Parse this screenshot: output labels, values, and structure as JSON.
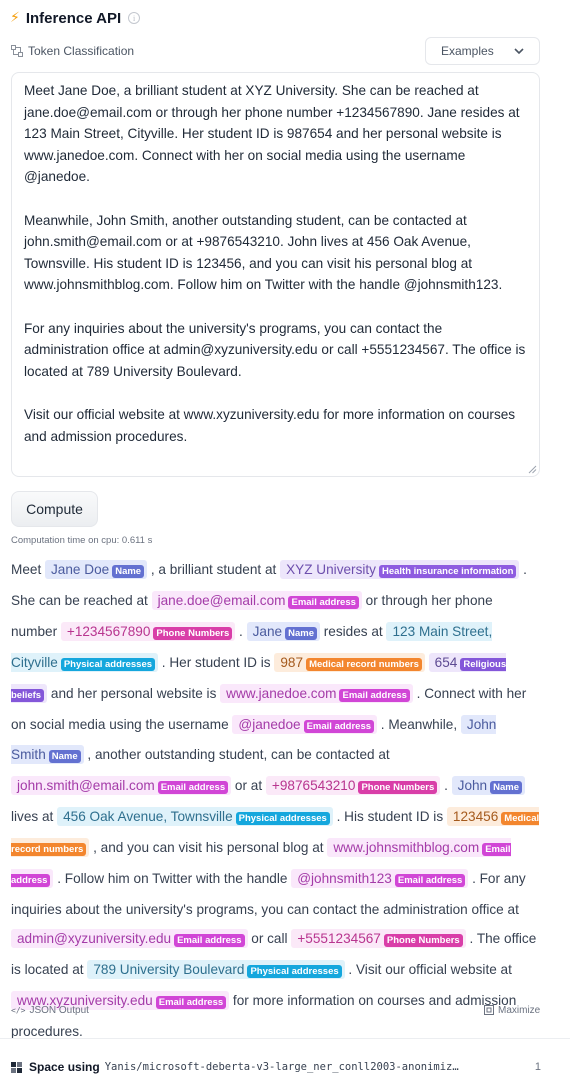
{
  "header": {
    "title": "Inference API"
  },
  "task": {
    "label": "Token Classification"
  },
  "examples": {
    "label": "Examples"
  },
  "input": {
    "paragraphs": [
      "Meet Jane Doe, a brilliant student at XYZ University. She can be reached at jane.doe@email.com or through her phone number +1234567890. Jane resides at 123 Main Street, Cityville. Her student ID is 987654 and her personal website is www.janedoe.com. Connect with her on social media using the username @janedoe.",
      "Meanwhile, John Smith, another outstanding student, can be contacted at john.smith@email.com or at +9876543210. John lives at 456 Oak Avenue, Townsville. His student ID is 123456, and you can visit his personal blog at www.johnsmithblog.com. Follow him on Twitter with the handle @johnsmith123.",
      "For any inquiries about the university's programs, you can contact the administration office at admin@xyzuniversity.edu or call +5551234567. The office is located at 789 University Boulevard.",
      "Visit our official website at www.xyzuniversity.edu for more information on courses and admission procedures."
    ]
  },
  "compute": {
    "label": "Compute",
    "time": "Computation time on cpu: 0.611 s"
  },
  "colors": {
    "Name": "#6371d1",
    "Health insurance information": "#8e5ce0",
    "Email address": "#d146d6",
    "Phone Numbers": "#d93ea8",
    "Physical addresses": "#15a7dd",
    "Medical record numbers": "#f3862e",
    "Religious beliefs": "#8457d9"
  },
  "output": {
    "segments": [
      {
        "t": "Meet "
      },
      {
        "e": "Jane Doe",
        "l": "Name",
        "c": "name"
      },
      {
        "t": " , a brilliant student at "
      },
      {
        "e": "XYZ University",
        "l": "Health insurance information",
        "c": "health"
      },
      {
        "t": " . She can be reached at "
      },
      {
        "e": "jane.doe@email.com",
        "l": "Email address",
        "c": "email"
      },
      {
        "t": "  or through her phone number "
      },
      {
        "e": "+1234567890",
        "l": "Phone Numbers",
        "c": "phone"
      },
      {
        "t": " . "
      },
      {
        "e": "Jane",
        "l": "Name",
        "c": "name"
      },
      {
        "t": "  resides at "
      },
      {
        "e": "123 Main Street, Cityville",
        "l": "Physical addresses",
        "c": "addr"
      },
      {
        "t": " . Her student ID is "
      },
      {
        "e": "987",
        "l": "Medical record numbers",
        "c": "med"
      },
      {
        "t": " "
      },
      {
        "e": "654",
        "l": "Religious beliefs",
        "c": "relig"
      },
      {
        "t": "  and her personal website is "
      },
      {
        "e": "www.janedoe.com",
        "l": "Email address",
        "c": "email"
      },
      {
        "t": " . Connect with her on social media using the username "
      },
      {
        "e": "@janedoe",
        "l": "Email address",
        "c": "email"
      },
      {
        "t": " . Meanwhile, "
      },
      {
        "e": "John Smith",
        "l": "Name",
        "c": "name"
      },
      {
        "t": " , another outstanding student, can be contacted at "
      },
      {
        "e": "john.smith@email.com",
        "l": "Email address",
        "c": "email"
      },
      {
        "t": "  or at "
      },
      {
        "e": "+9876543210",
        "l": "Phone Numbers",
        "c": "phone"
      },
      {
        "t": " . "
      },
      {
        "e": "John",
        "l": "Name",
        "c": "name"
      },
      {
        "t": "  lives at "
      },
      {
        "e": "456 Oak Avenue, Townsville",
        "l": "Physical addresses",
        "c": "addr"
      },
      {
        "t": " . His student ID is "
      },
      {
        "e": "123456",
        "l": "Medical record numbers",
        "c": "med"
      },
      {
        "t": " , and you can visit his personal blog at "
      },
      {
        "e": "www.johnsmithblog.com",
        "l": "Email address",
        "c": "email"
      },
      {
        "t": " . Follow him on Twitter with the handle "
      },
      {
        "e": "@johnsmith123",
        "l": "Email address",
        "c": "email"
      },
      {
        "t": " . For any inquiries about the university's programs, you can contact the administration office at "
      },
      {
        "e": "admin@xyzuniversity.edu",
        "l": "Email address",
        "c": "email"
      },
      {
        "t": "  or call "
      },
      {
        "e": "+5551234567",
        "l": "Phone Numbers",
        "c": "phone"
      },
      {
        "t": " . The office is located at "
      },
      {
        "e": "789 University Boulevard",
        "l": "Physical addresses",
        "c": "addr"
      },
      {
        "t": " . Visit our official website at "
      },
      {
        "e": "www.xyzuniversity.edu",
        "l": "Email address",
        "c": "email"
      },
      {
        "t": "  for more information on courses and admission procedures."
      }
    ]
  },
  "footer": {
    "json_output": "JSON Output",
    "maximize": "Maximize",
    "space_label": "Space using",
    "space_name": "Yanis/microsoft-deberta-v3-large_ner_conll2003-anonimiz…",
    "space_count": "1"
  }
}
